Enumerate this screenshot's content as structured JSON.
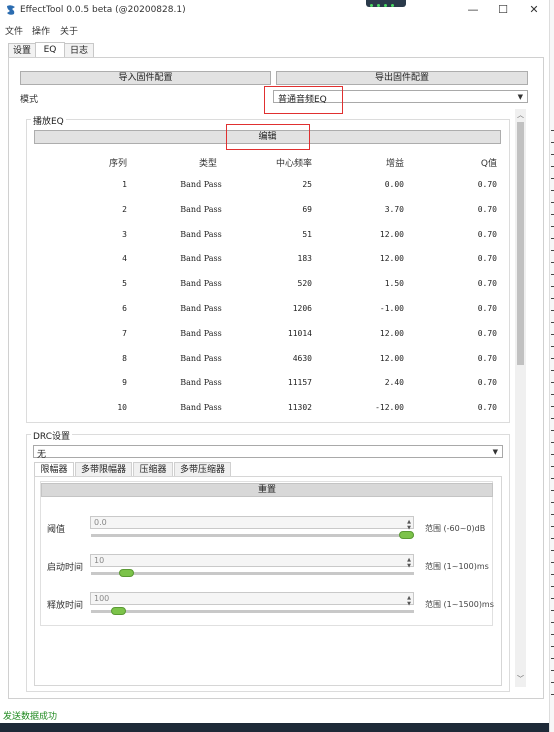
{
  "window": {
    "title": "EffectTool 0.0.5 beta (@20200828.1)",
    "minimize": "—",
    "maximize": "☐",
    "close": "✕"
  },
  "menu": [
    "文件",
    "操作",
    "关于"
  ],
  "tabs": [
    {
      "label": "设置",
      "active": false
    },
    {
      "label": "EQ",
      "active": true
    },
    {
      "label": "日志",
      "active": false
    }
  ],
  "eq": {
    "import_button": "导入固件配置",
    "export_button": "导出固件配置",
    "mode_label": "模式",
    "mode_value": "普通音频EQ",
    "group_title": "播放EQ",
    "edit_button": "编辑",
    "columns": [
      "序列",
      "类型",
      "中心频率",
      "增益",
      "Q值"
    ],
    "rows": [
      [
        "1",
        "Band Pass",
        "25",
        "0.00",
        "0.70"
      ],
      [
        "2",
        "Band Pass",
        "69",
        "3.70",
        "0.70"
      ],
      [
        "3",
        "Band Pass",
        "51",
        "12.00",
        "0.70"
      ],
      [
        "4",
        "Band Pass",
        "183",
        "12.00",
        "0.70"
      ],
      [
        "5",
        "Band Pass",
        "520",
        "1.50",
        "0.70"
      ],
      [
        "6",
        "Band Pass",
        "1206",
        "-1.00",
        "0.70"
      ],
      [
        "7",
        "Band Pass",
        "11014",
        "12.00",
        "0.70"
      ],
      [
        "8",
        "Band Pass",
        "4630",
        "12.00",
        "0.70"
      ],
      [
        "9",
        "Band Pass",
        "11157",
        "2.40",
        "0.70"
      ],
      [
        "10",
        "Band Pass",
        "11302",
        "-12.00",
        "0.70"
      ]
    ]
  },
  "drc": {
    "group_title": "DRC设置",
    "mode_value": "无",
    "subtabs": [
      {
        "label": "限幅器",
        "active": true
      },
      {
        "label": "多带限幅器",
        "active": false
      },
      {
        "label": "压缩器",
        "active": false
      },
      {
        "label": "多带压缩器",
        "active": false
      }
    ],
    "reset_button": "重置",
    "params": [
      {
        "label": "阈值",
        "value": "0.0",
        "range": "范围 (-60~0)dB",
        "level": 1.0
      },
      {
        "label": "启动时间",
        "value": "10",
        "range": "范围 (1~100)ms",
        "level": 0.09
      },
      {
        "label": "释放时间",
        "value": "100",
        "range": "范围 (1~1500)ms",
        "level": 0.066
      }
    ]
  },
  "status": "发送数据成功",
  "colors": {
    "status_text": "#1f8a1f",
    "highlight_box": "#e03030",
    "slider_thumb": "#7cc34a"
  }
}
